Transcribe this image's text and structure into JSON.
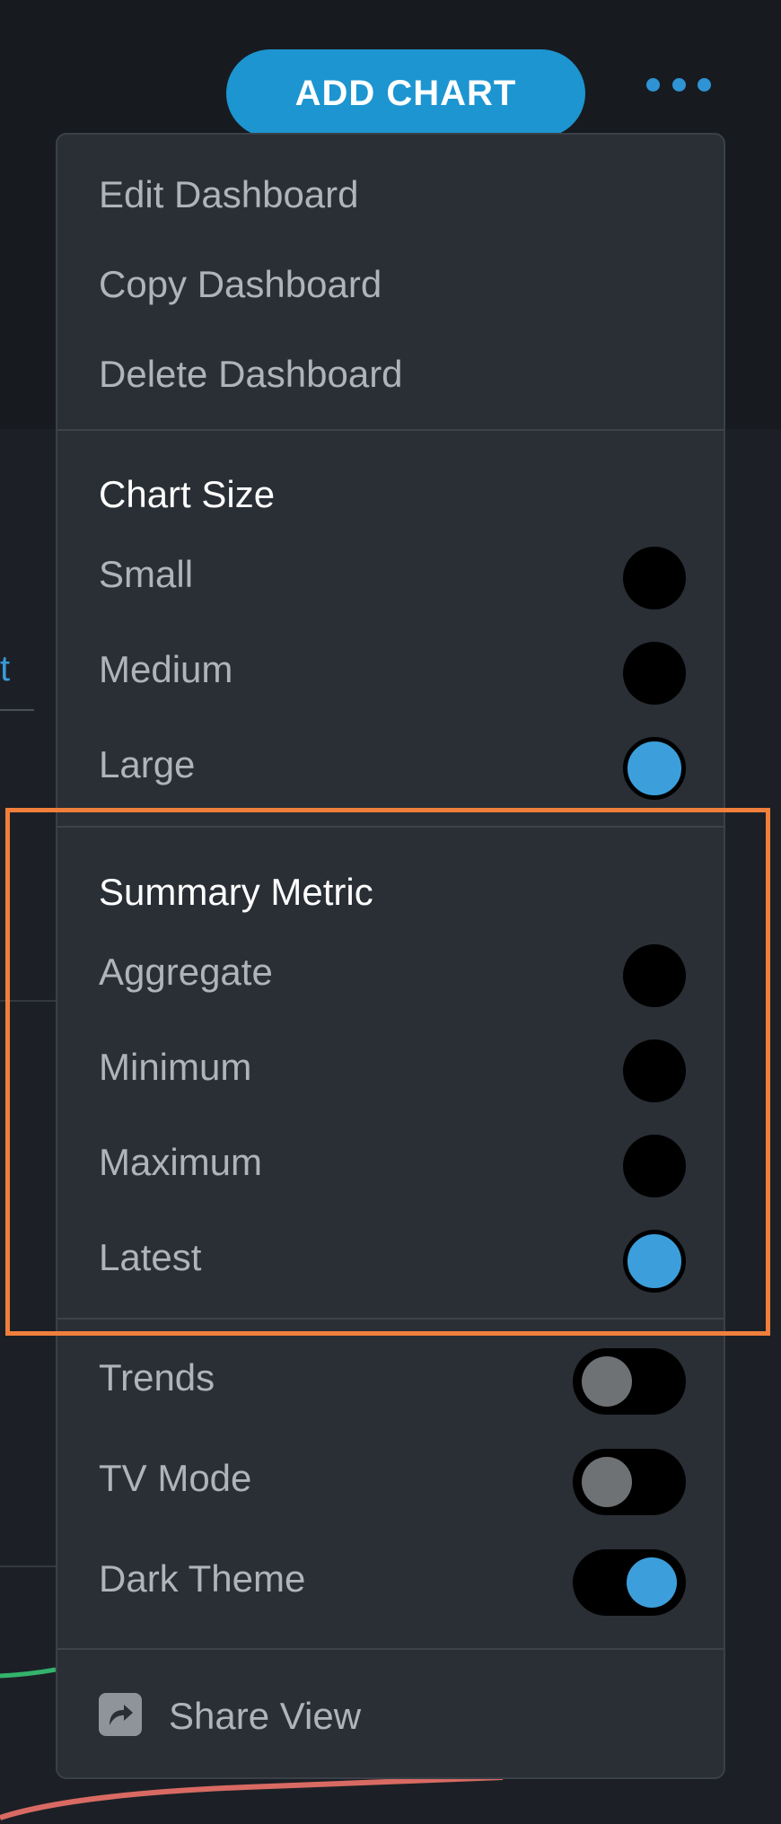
{
  "header": {
    "add_chart_label": "ADD CHART",
    "more_icon": "more-horizontal-icon",
    "accent_color": "#1d95d0"
  },
  "background": {
    "link_fragment": "t"
  },
  "menu": {
    "actions": [
      {
        "label": "Edit Dashboard"
      },
      {
        "label": "Copy Dashboard"
      },
      {
        "label": "Delete Dashboard"
      }
    ],
    "chart_size": {
      "title": "Chart Size",
      "options": [
        {
          "label": "Small",
          "selected": false
        },
        {
          "label": "Medium",
          "selected": false
        },
        {
          "label": "Large",
          "selected": true
        }
      ]
    },
    "summary_metric": {
      "title": "Summary Metric",
      "options": [
        {
          "label": "Aggregate",
          "selected": false
        },
        {
          "label": "Minimum",
          "selected": false
        },
        {
          "label": "Maximum",
          "selected": false
        },
        {
          "label": "Latest",
          "selected": true
        }
      ]
    },
    "toggles": [
      {
        "label": "Trends",
        "on": false
      },
      {
        "label": "TV Mode",
        "on": false
      },
      {
        "label": "Dark Theme",
        "on": true
      }
    ],
    "share": {
      "label": "Share View",
      "icon": "share-icon"
    }
  },
  "colors": {
    "selected": "#3c9fdb",
    "highlight": "#f07f3c",
    "menu_bg": "#2a2f36"
  }
}
